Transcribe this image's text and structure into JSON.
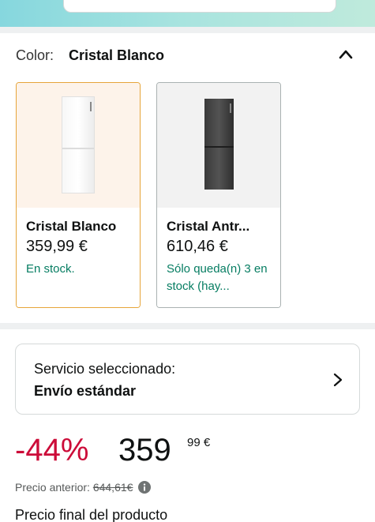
{
  "colors": {
    "accent_selected": "#e6a53a",
    "discount": "#cc0c39",
    "in_stock": "#067d62"
  },
  "color_selector": {
    "label": "Color:",
    "selected": "Cristal Blanco",
    "collapse_icon": "chevron-up-icon",
    "options": [
      {
        "name": "Cristal Blanco",
        "price": "359,99 €",
        "stock": "En stock.",
        "selected": true
      },
      {
        "name": "Cristal Antr...",
        "price": "610,46 €",
        "stock": "Sólo queda(n) 3 en stock (hay...",
        "selected": false
      }
    ]
  },
  "service": {
    "title": "Servicio seleccionado:",
    "value": "Envío estándar",
    "icon": "chevron-right-icon"
  },
  "pricing": {
    "discount": "-44%",
    "price_integer": "359",
    "price_fraction": "99 €",
    "previous_label": "Precio anterior:",
    "previous_price": "644,61€",
    "info_icon": "info-icon",
    "final_label": "Precio final del producto"
  }
}
